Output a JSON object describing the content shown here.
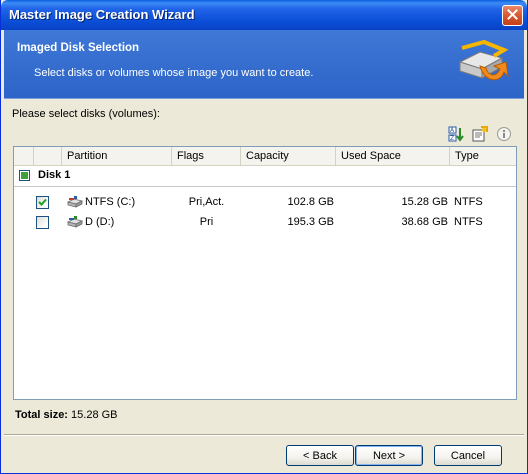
{
  "window": {
    "title": "Master Image Creation Wizard"
  },
  "banner": {
    "heading": "Imaged Disk Selection",
    "description": "Select disks or volumes whose image you want to create."
  },
  "prompt": "Please select disks (volumes):",
  "columns": {
    "partition": "Partition",
    "flags": "Flags",
    "capacity": "Capacity",
    "used_space": "Used Space",
    "type": "Type"
  },
  "disk": {
    "label": "Disk 1",
    "partitions": [
      {
        "name": "NTFS (C:)",
        "flags": "Pri,Act.",
        "capacity": "102.8 GB",
        "used_space": "15.28 GB",
        "type": "NTFS",
        "checked": true
      },
      {
        "name": "D (D:)",
        "flags": "Pri",
        "capacity": "195.3 GB",
        "used_space": "38.68 GB",
        "type": "NTFS",
        "checked": false
      }
    ]
  },
  "total": {
    "label": "Total size:",
    "value": "15.28 GB"
  },
  "buttons": {
    "back": "< Back",
    "next": "Next >",
    "cancel": "Cancel"
  },
  "icons": {
    "close": "close-icon",
    "wizard": "disk-image-icon",
    "sort": "sort-icon",
    "properties": "properties-icon",
    "info": "info-icon",
    "partition": "partition-icon"
  },
  "colors": {
    "titlebar": "#0b4fd8",
    "banner": "#3f78d6",
    "check_green": "#21a121"
  }
}
